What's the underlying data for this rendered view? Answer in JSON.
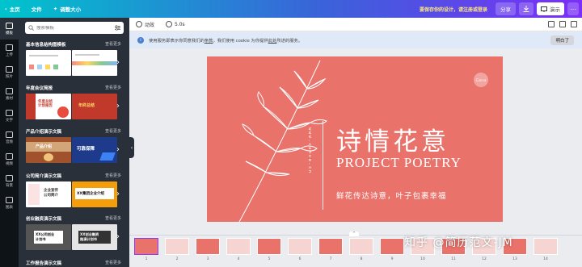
{
  "topbar": {
    "home": "主页",
    "file": "文件",
    "resize": "调整大小",
    "upgrade_note": "要保存你的设计，请注册或登录",
    "share": "分享",
    "present": "演示"
  },
  "rail": [
    {
      "label": "模板",
      "icon": "template-icon"
    },
    {
      "label": "上传",
      "icon": "upload-icon"
    },
    {
      "label": "照片",
      "icon": "photo-icon"
    },
    {
      "label": "素材",
      "icon": "elements-icon"
    },
    {
      "label": "文字",
      "icon": "text-icon"
    },
    {
      "label": "音频",
      "icon": "audio-icon"
    },
    {
      "label": "视频",
      "icon": "video-icon"
    },
    {
      "label": "背景",
      "icon": "background-icon"
    },
    {
      "label": "图表",
      "icon": "chart-icon"
    }
  ],
  "panel": {
    "search_placeholder": "搜索模板",
    "see_all": "查看更多",
    "sections": [
      {
        "title": "基本信息结构图模板",
        "thumbs": [
          "",
          ""
        ]
      },
      {
        "title": "年度会议简报",
        "thumbs": [
          "年度总结\n计划报告",
          "年终总结"
        ]
      },
      {
        "title": "产品介绍演示文稿",
        "thumbs": [
          "产品介绍",
          "可靠保障"
        ]
      },
      {
        "title": "公司简介演示文稿",
        "thumbs": [
          "企业宣传\n公司简介",
          "XX集团企业介绍"
        ]
      },
      {
        "title": "创业融资演示文稿",
        "thumbs": [
          "XX公司创业\n计划书",
          "XX创业融资\n路演计划书"
        ]
      },
      {
        "title": "工作报告演示文稿",
        "thumbs": []
      }
    ]
  },
  "toolbar": {
    "animate": "动效",
    "duration": "5.0s"
  },
  "cookie": {
    "text_before": "使用服务即表示你同意我们的",
    "terms": "条款",
    "text_mid": "。我们使用 cookie 为你提供",
    "privacy": "此处",
    "text_after": "所述的服务。",
    "got_it": "明白了"
  },
  "slide": {
    "title_cn": "诗情花意",
    "title_en": "PROJECT POETRY",
    "subtitle": "鲜花传达诗意，叶子包裹幸福",
    "vertical_text": "www.canva.cn",
    "logo": "Canva",
    "background_color": "#e9726b"
  },
  "filmstrip": {
    "frames": [
      "1",
      "2",
      "3",
      "4",
      "5",
      "6",
      "7",
      "8",
      "9",
      "10",
      "11",
      "12",
      "13",
      "14"
    ],
    "active_index": 0
  },
  "watermark": "知乎 @简历范文-JM"
}
